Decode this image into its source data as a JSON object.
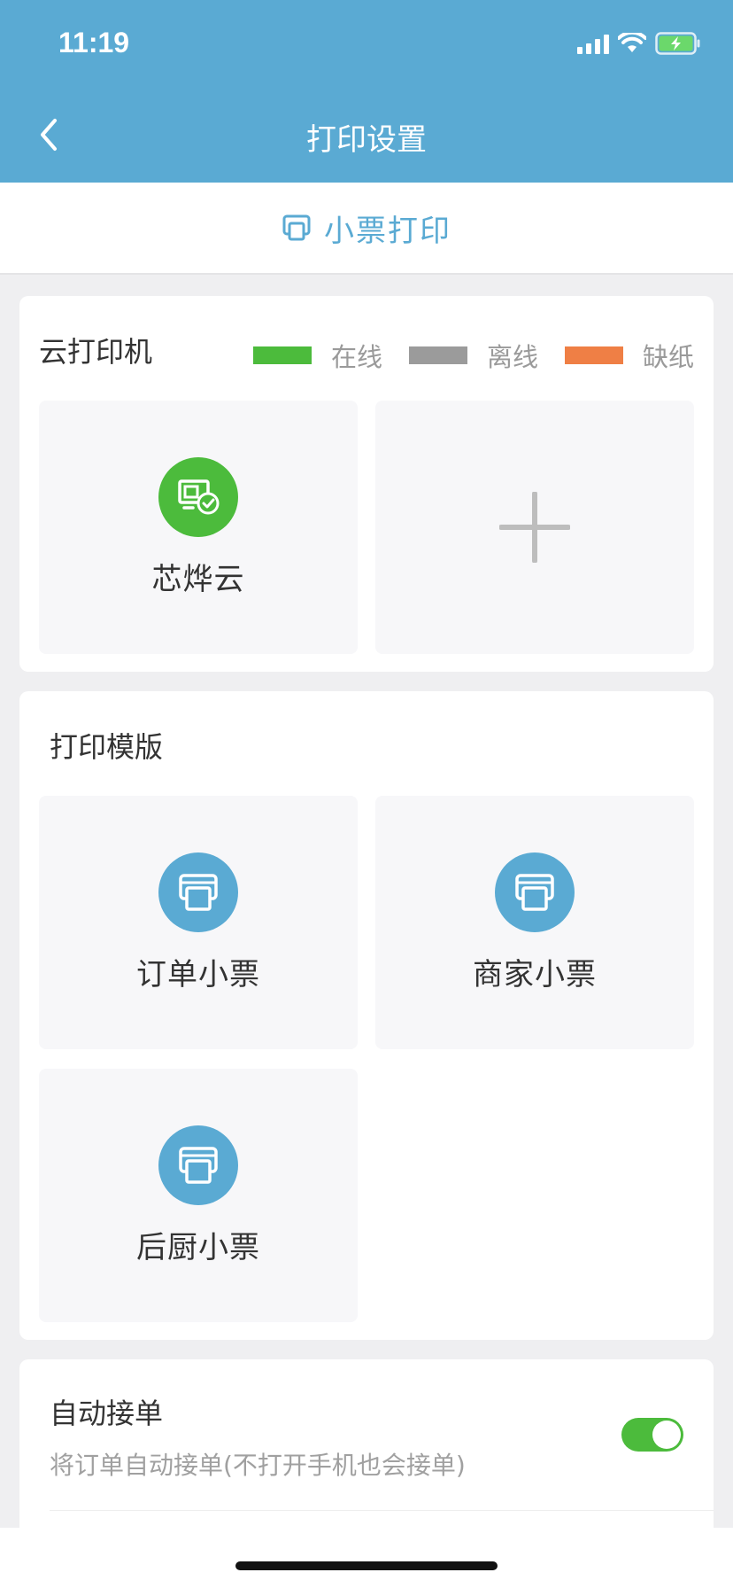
{
  "status": {
    "time": "11:19"
  },
  "nav": {
    "title": "打印设置"
  },
  "tab": {
    "label": "小票打印"
  },
  "printers": {
    "title": "云打印机",
    "legend": [
      {
        "label": "在线",
        "color": "#4cbb3c"
      },
      {
        "label": "离线",
        "color": "#9b9b9b"
      },
      {
        "label": "缺纸",
        "color": "#ef7f45"
      }
    ],
    "items": [
      {
        "label": "芯烨云",
        "status": "online",
        "icon": "printer-online-icon"
      }
    ],
    "add_icon": "plus-icon"
  },
  "templates": {
    "title": "打印模版",
    "items": [
      {
        "label": "订单小票",
        "icon": "receipt-printer-icon"
      },
      {
        "label": "商家小票",
        "icon": "receipt-printer-icon"
      },
      {
        "label": "后厨小票",
        "icon": "receipt-printer-icon"
      }
    ]
  },
  "auto_accept": {
    "title": "自动接单",
    "description": "将订单自动接单(不打开手机也会接单)",
    "enabled": true
  },
  "colors": {
    "brand": "#5aaad3",
    "online": "#4cbb3c",
    "offline": "#9b9b9b",
    "paper_out": "#ef7f45"
  }
}
